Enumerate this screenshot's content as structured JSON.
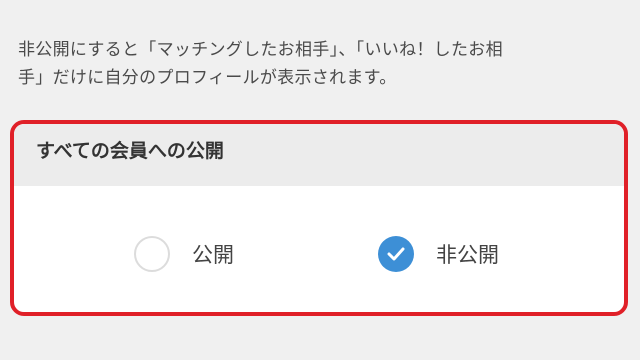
{
  "description": {
    "line1": "非公開にすると「マッチングしたお相手」、「いいね！したお相",
    "line2": "手」だけに自分のプロフィールが表示されます。"
  },
  "visibility_setting": {
    "title": "すべての会員への公開",
    "options": [
      {
        "label": "公開",
        "selected": false
      },
      {
        "label": "非公開",
        "selected": true
      }
    ]
  },
  "colors": {
    "highlight_border": "#e02028",
    "check_accent": "#3d8fd6"
  }
}
